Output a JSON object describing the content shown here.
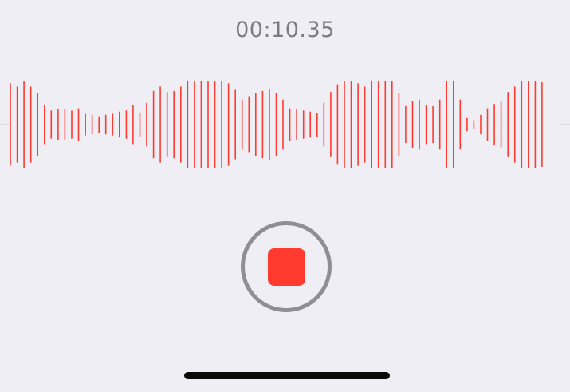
{
  "recorder": {
    "elapsed_time": "00:10.35",
    "state": "recording",
    "accent_color": "#ff3b30",
    "waveform_color": "#ff3b30",
    "waveform_levels": [
      0.76,
      0.7,
      0.8,
      0.7,
      0.58,
      0.36,
      0.26,
      0.28,
      0.28,
      0.26,
      0.3,
      0.2,
      0.18,
      0.15,
      0.18,
      0.2,
      0.24,
      0.26,
      0.36,
      0.22,
      0.4,
      0.62,
      0.7,
      0.6,
      0.62,
      0.7,
      0.8,
      0.8,
      0.8,
      0.8,
      0.8,
      0.8,
      0.76,
      0.64,
      0.46,
      0.52,
      0.58,
      0.62,
      0.66,
      0.58,
      0.46,
      0.3,
      0.28,
      0.26,
      0.24,
      0.22,
      0.4,
      0.6,
      0.74,
      0.8,
      0.8,
      0.76,
      0.7,
      0.8,
      0.8,
      0.8,
      0.8,
      0.58,
      0.34,
      0.44,
      0.46,
      0.36,
      0.34,
      0.46,
      0.8,
      0.8,
      0.46,
      0.12,
      0.08,
      0.18,
      0.3,
      0.38,
      0.42,
      0.6,
      0.7,
      0.8,
      0.8,
      0.8,
      0.78
    ]
  }
}
